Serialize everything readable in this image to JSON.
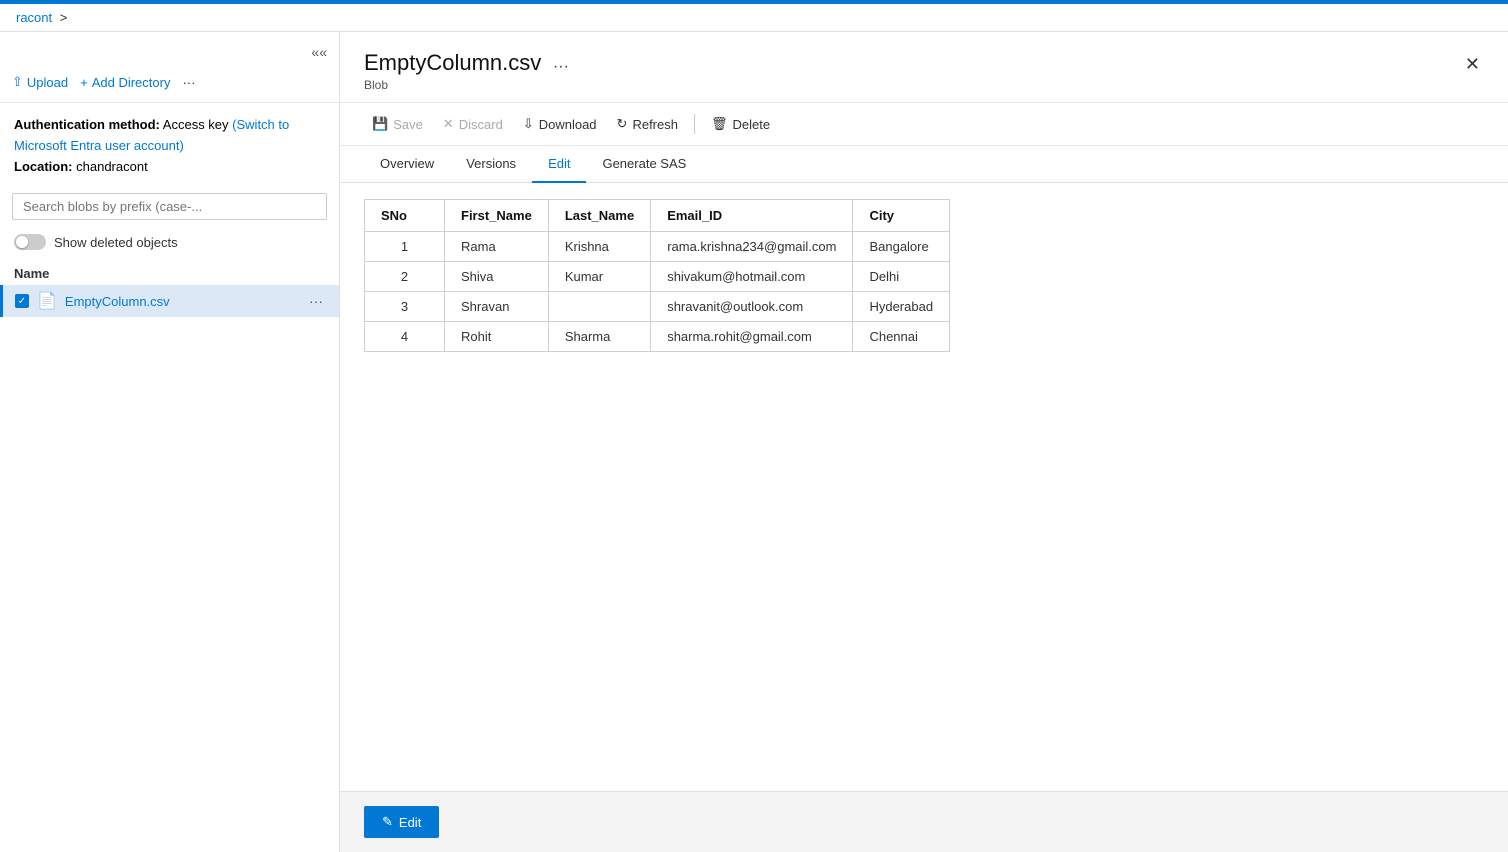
{
  "topbar": {
    "color": "#0078d4"
  },
  "breadcrumb": {
    "link": "racont",
    "separator": ">"
  },
  "sidebar": {
    "collapse_tooltip": "Collapse",
    "toolbar": {
      "upload_label": "Upload",
      "add_directory_label": "Add Directory",
      "more_label": "···"
    },
    "auth_label": "Authentication method:",
    "auth_value": "Access key",
    "auth_link_text": "(Switch to Microsoft Entra user account)",
    "location_label": "Location:",
    "location_value": "chandracont",
    "search_placeholder": "Search blobs by prefix (case-...",
    "toggle_label": "Show deleted objects",
    "section_label": "Name",
    "file": {
      "name": "EmptyColumn.csv",
      "more_label": "···"
    }
  },
  "panel": {
    "title": "EmptyColumn.csv",
    "menu_label": "···",
    "subtitle": "Blob",
    "close_label": "✕",
    "toolbar": {
      "save_label": "Save",
      "discard_label": "Discard",
      "download_label": "Download",
      "refresh_label": "Refresh",
      "delete_label": "Delete"
    },
    "tabs": [
      {
        "id": "overview",
        "label": "Overview"
      },
      {
        "id": "versions",
        "label": "Versions"
      },
      {
        "id": "edit",
        "label": "Edit",
        "active": true
      },
      {
        "id": "generate-sas",
        "label": "Generate SAS"
      }
    ],
    "table": {
      "headers": [
        "SNo",
        "First_Name",
        "Last_Name",
        "Email_ID",
        "City"
      ],
      "rows": [
        {
          "sno": "1",
          "first_name": "Rama",
          "last_name": "Krishna",
          "email": "rama.krishna234@gmail.com",
          "city": "Bangalore"
        },
        {
          "sno": "2",
          "first_name": "Shiva",
          "last_name": "Kumar",
          "email": "shivakum@hotmail.com",
          "city": "Delhi"
        },
        {
          "sno": "3",
          "first_name": "Shravan",
          "last_name": "",
          "email": "shravanit@outlook.com",
          "city": "Hyderabad"
        },
        {
          "sno": "4",
          "first_name": "Rohit",
          "last_name": "Sharma",
          "email": "sharma.rohit@gmail.com",
          "city": "Chennai"
        }
      ]
    },
    "edit_button_label": "Edit"
  }
}
